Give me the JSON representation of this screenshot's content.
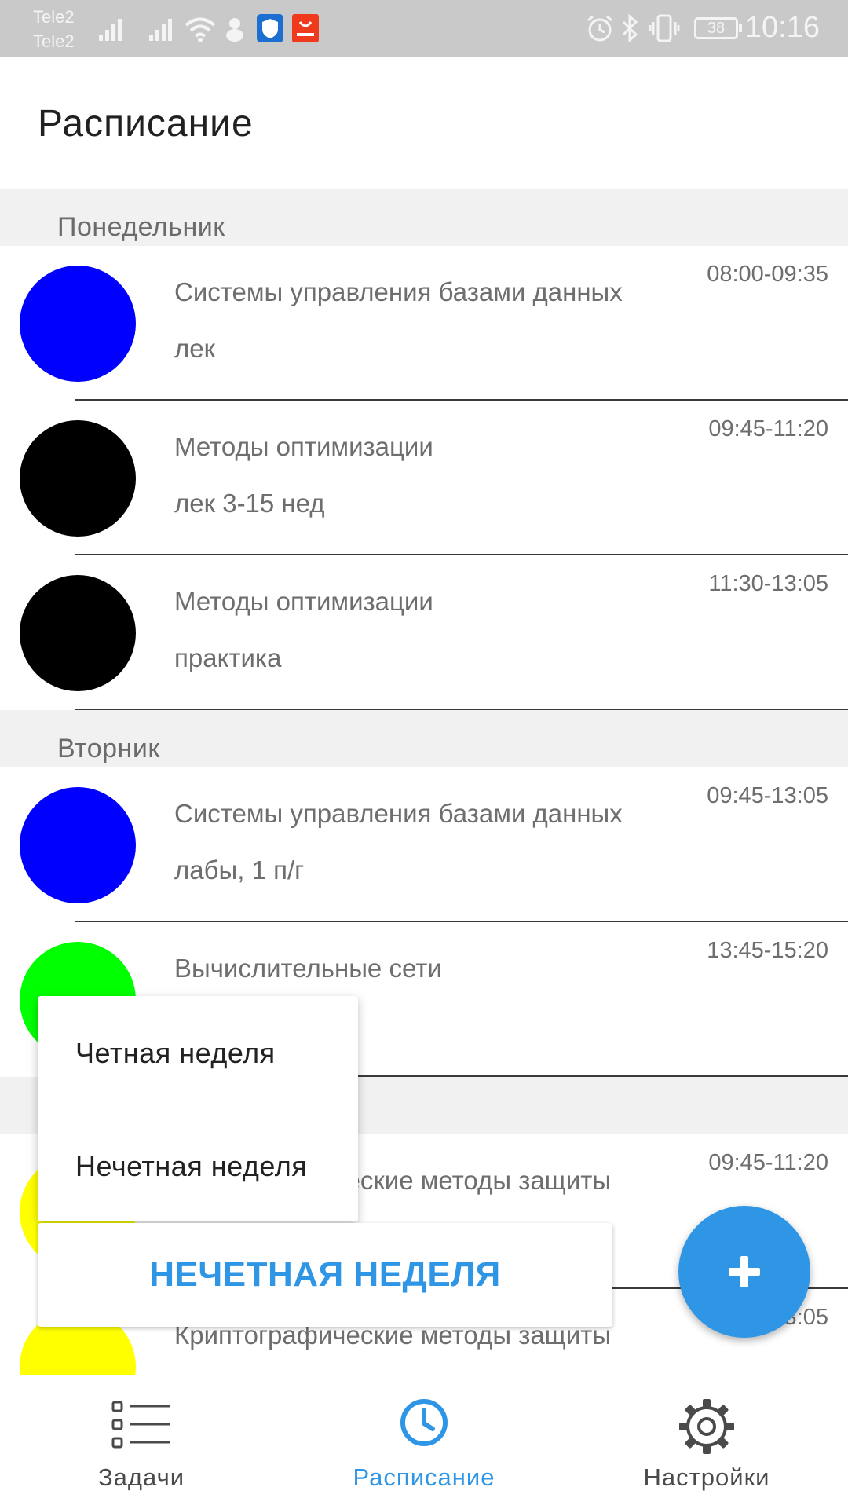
{
  "status_bar": {
    "carrier_1": "Tele2",
    "carrier_2": "Tele2",
    "battery": "38",
    "time": "10:16"
  },
  "app_bar": {
    "title": "Расписание"
  },
  "schedule": [
    {
      "day": "Понедельник",
      "items": [
        {
          "title": "Системы управления базами данных",
          "subtitle": "лек",
          "time": "08:00-09:35",
          "color": "#0000ff"
        },
        {
          "title": "Методы оптимизации",
          "subtitle": "лек 3-15 нед",
          "time": "09:45-11:20",
          "color": "#000000"
        },
        {
          "title": "Методы оптимизации",
          "subtitle": "практика",
          "time": "11:30-13:05",
          "color": "#000000"
        }
      ]
    },
    {
      "day": "Вторник",
      "items": [
        {
          "title": "Системы управления базами данных",
          "subtitle": "лабы, 1 п/г",
          "time": "09:45-13:05",
          "color": "#0000ff"
        },
        {
          "title": "Вычислительные сети",
          "subtitle": "",
          "time": "13:45-15:20",
          "color": "#00ff00"
        }
      ]
    },
    {
      "day": "",
      "items": [
        {
          "title": "Криптографические методы защиты",
          "subtitle": "",
          "time": "09:45-11:20",
          "color": "#ffff00"
        },
        {
          "title": "Криптографические методы защиты",
          "subtitle": "",
          "time": "11:30-13:05",
          "color": "#ffff00"
        }
      ]
    }
  ],
  "week_menu": {
    "options": [
      "Четная неделя",
      "Нечетная неделя"
    ]
  },
  "week_button": {
    "label": "НЕЧЕТНАЯ НЕДЕЛЯ"
  },
  "fab": {
    "icon": "plus-icon"
  },
  "bottom_nav": {
    "items": [
      {
        "label": "Задачи",
        "icon": "list-icon"
      },
      {
        "label": "Расписание",
        "icon": "clock-icon",
        "active": true
      },
      {
        "label": "Настройки",
        "icon": "gear-icon"
      }
    ]
  },
  "colors": {
    "accent": "#2f96e6",
    "status_bar": "#c9c9c9",
    "section_bg": "#f1f1f1"
  }
}
